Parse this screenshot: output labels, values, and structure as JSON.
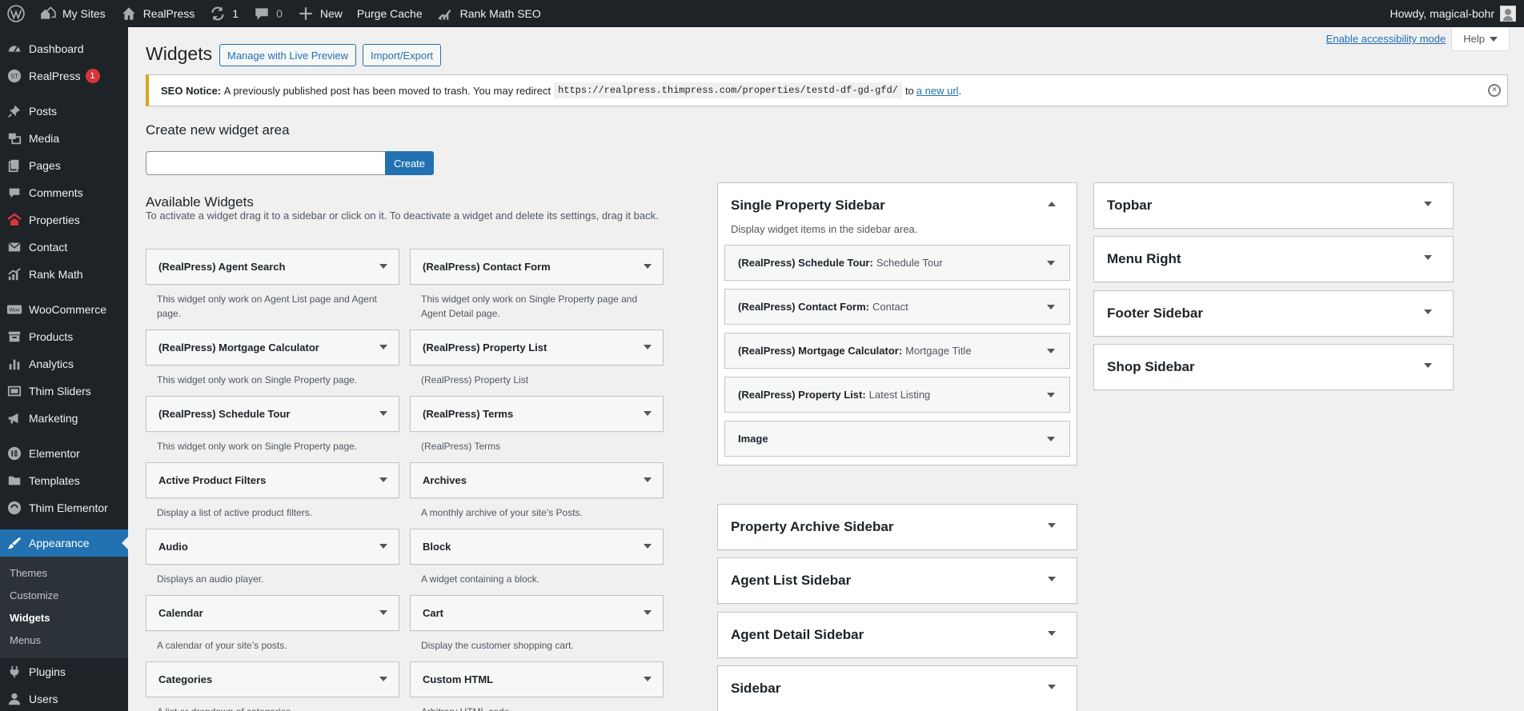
{
  "adminbar": {
    "my_sites": "My Sites",
    "site_name": "RealPress",
    "updates_count": "1",
    "comments_count": "0",
    "new_label": "New",
    "purge_cache": "Purge Cache",
    "rank_math": "Rank Math SEO",
    "howdy": "Howdy, magical-bohr"
  },
  "menu": {
    "dashboard": "Dashboard",
    "realpress": "RealPress",
    "realpress_badge": "1",
    "posts": "Posts",
    "media": "Media",
    "pages": "Pages",
    "comments": "Comments",
    "properties": "Properties",
    "contact": "Contact",
    "rank_math": "Rank Math",
    "woocommerce": "WooCommerce",
    "products": "Products",
    "analytics": "Analytics",
    "thim_sliders": "Thim Sliders",
    "marketing": "Marketing",
    "elementor": "Elementor",
    "templates": "Templates",
    "thim_elementor": "Thim Elementor",
    "appearance": "Appearance",
    "sub": {
      "themes": "Themes",
      "customize": "Customize",
      "widgets": "Widgets",
      "menus": "Menus"
    },
    "plugins": "Plugins",
    "users": "Users"
  },
  "screen": {
    "a11y_link": "Enable accessibility mode",
    "help": "Help"
  },
  "page": {
    "title": "Widgets",
    "live_preview_btn": "Manage with Live Preview",
    "import_export_btn": "Import/Export"
  },
  "notice": {
    "label": "SEO Notice:",
    "text": "A previously published post has been moved to trash. You may redirect",
    "url": "https://realpress.thimpress.com/properties/testd-df-gd-gfd/",
    "to": "to",
    "link": "a new url",
    "end": "."
  },
  "create_area": {
    "heading": "Create new widget area",
    "input_value": "",
    "button": "Create"
  },
  "available": {
    "heading": "Available Widgets",
    "description": "To activate a widget drag it to a sidebar or click on it. To deactivate a widget and delete its settings, drag it back.",
    "widgets": [
      {
        "name": "(RealPress) Agent Search",
        "desc": "This widget only work on Agent List page and Agent page."
      },
      {
        "name": "(RealPress) Contact Form",
        "desc": "This widget only work on Single Property page and Agent Detail page."
      },
      {
        "name": "(RealPress) Mortgage Calculator",
        "desc": "This widget only work on Single Property page."
      },
      {
        "name": "(RealPress) Property List",
        "desc": "(RealPress) Property List"
      },
      {
        "name": "(RealPress) Schedule Tour",
        "desc": "This widget only work on Single Property page."
      },
      {
        "name": "(RealPress) Terms",
        "desc": "(RealPress) Terms"
      },
      {
        "name": "Active Product Filters",
        "desc": "Display a list of active product filters."
      },
      {
        "name": "Archives",
        "desc": "A monthly archive of your site’s Posts."
      },
      {
        "name": "Audio",
        "desc": "Displays an audio player."
      },
      {
        "name": "Block",
        "desc": "A widget containing a block."
      },
      {
        "name": "Calendar",
        "desc": "A calendar of your site’s posts."
      },
      {
        "name": "Cart",
        "desc": "Display the customer shopping cart."
      },
      {
        "name": "Categories",
        "desc": "A list or dropdown of categories."
      },
      {
        "name": "Custom HTML",
        "desc": "Arbitrary HTML code."
      }
    ]
  },
  "sidebars": {
    "single_property": {
      "title": "Single Property Sidebar",
      "desc": "Display widget items in the sidebar area.",
      "widgets": [
        {
          "name": "(RealPress) Schedule Tour:",
          "title": "Schedule Tour"
        },
        {
          "name": "(RealPress) Contact Form:",
          "title": "Contact"
        },
        {
          "name": "(RealPress) Mortgage Calculator:",
          "title": "Mortgage Title"
        },
        {
          "name": "(RealPress) Property List:",
          "title": "Latest Listing"
        },
        {
          "name": "Image",
          "title": ""
        }
      ]
    },
    "property_archive": "Property Archive Sidebar",
    "agent_list": "Agent List Sidebar",
    "agent_detail": "Agent Detail Sidebar",
    "sidebar": "Sidebar",
    "topbar": "Topbar",
    "menu_right": "Menu Right",
    "footer": "Footer Sidebar",
    "shop": "Shop Sidebar"
  }
}
